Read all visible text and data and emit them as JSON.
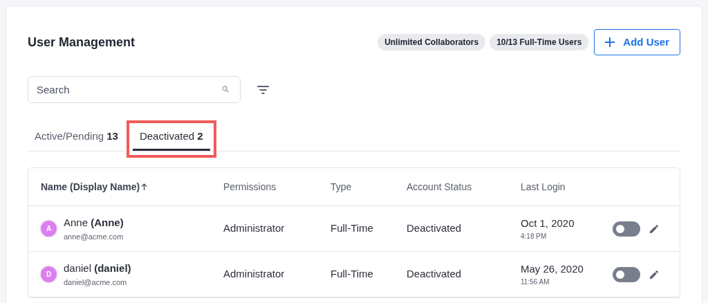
{
  "title": "User Management",
  "badges": [
    "Unlimited Collaborators",
    "10/13 Full-Time Users"
  ],
  "add_button": {
    "label": "Add User"
  },
  "search": {
    "placeholder": "Search"
  },
  "tabs": [
    {
      "label": "Active/Pending",
      "count": "13",
      "selected": false,
      "highlighted": false
    },
    {
      "label": "Deactivated",
      "count": "2",
      "selected": true,
      "highlighted": true
    }
  ],
  "table": {
    "columns": [
      {
        "label": "Name (Display Name)",
        "sorted": true
      },
      {
        "label": "Permissions",
        "sorted": false
      },
      {
        "label": "Type",
        "sorted": false
      },
      {
        "label": "Account Status",
        "sorted": false
      },
      {
        "label": "Last Login",
        "sorted": false
      }
    ],
    "rows": [
      {
        "initial": "A",
        "color": "#dc7ef0",
        "name": "Anne **(Anne)**",
        "email": "anne@acme.com",
        "permissions": "Administrator",
        "type": "Full-Time",
        "status": "Deactivated",
        "date": "Oct 1, 2020",
        "time": "4:18 PM",
        "on": false
      },
      {
        "initial": "D",
        "color": "#dc7ef0",
        "name": "daniel **(daniel)**",
        "email": "daniel@acme.com",
        "permissions": "Administrator",
        "type": "Full-Time",
        "status": "Deactivated",
        "date": "May 26, 2020",
        "time": "11:56 AM",
        "on": false
      }
    ]
  }
}
